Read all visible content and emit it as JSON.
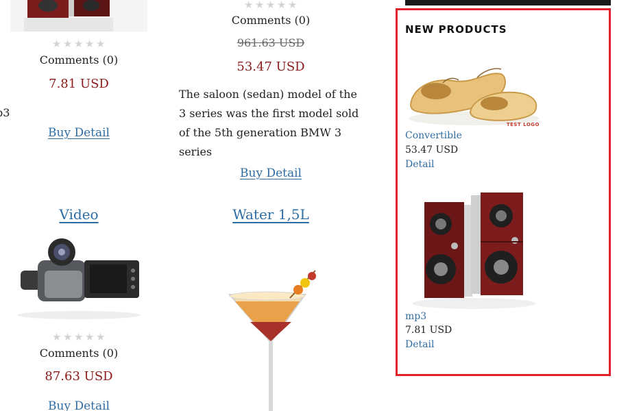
{
  "products": {
    "col1_top": {
      "comments": "Comments (0)",
      "price": "7.81 USD",
      "partial_text": "p3",
      "buy_label": "Buy Detail"
    },
    "col2_top": {
      "comments": "Comments (0)",
      "old_price": "961.63 USD",
      "price": "53.47 USD",
      "description_lines": [
        "The saloon (sedan) model of the",
        "3 series was the first model sold",
        "of the 5th generation BMW 3",
        "series"
      ],
      "buy_label": "Buy Detail"
    },
    "video": {
      "title": "Video",
      "comments": "Comments (0)",
      "price": "87.63 USD",
      "buy_label": "Buy Detail"
    },
    "water": {
      "title": "Water 1,5L"
    }
  },
  "sidebar": {
    "title": "NEW PRODUCTS",
    "items": [
      {
        "name": "Convertible",
        "price": "53.47 USD",
        "detail": "Detail",
        "logo_text": "TEST LOGO",
        "image": "wooden-clogs"
      },
      {
        "name": "mp3",
        "price": "7.81 USD",
        "detail": "Detail",
        "image": "speakers"
      }
    ]
  },
  "colors": {
    "price": "#8b1a1a",
    "link": "#2e6da4",
    "widget_border": "#e3212a"
  },
  "icons": {
    "rating": "star-icon"
  }
}
